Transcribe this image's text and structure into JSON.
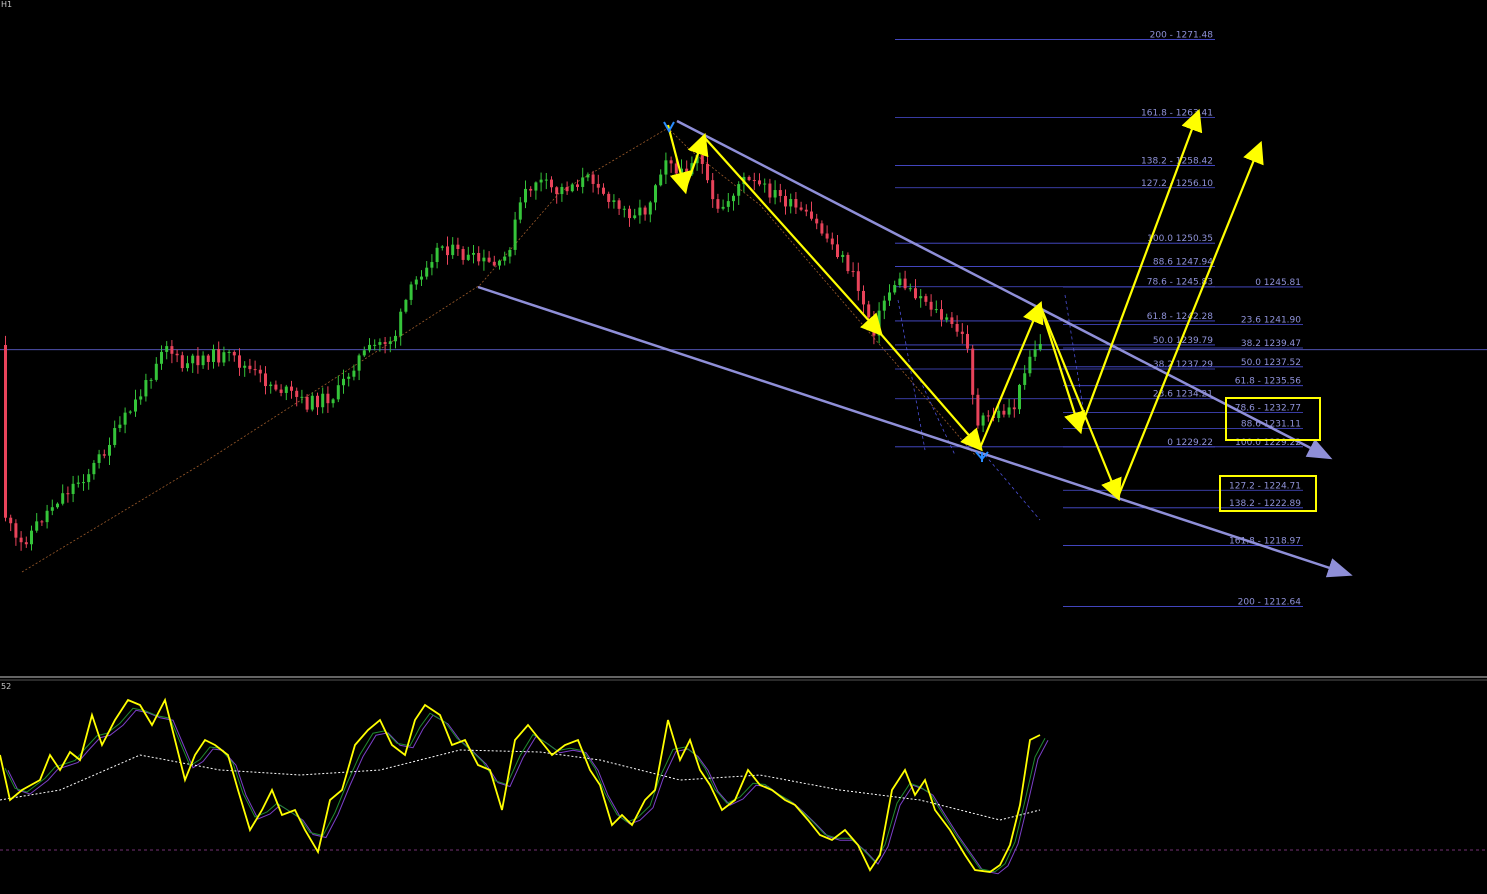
{
  "header": {
    "timeframe": "H1",
    "subwindow_label": "52"
  },
  "colors": {
    "background": "#000000",
    "bull_candle": "#35c43a",
    "bear_candle": "#e8435a",
    "fib_line": "#4b4fd8",
    "fib_text": "#8f92d8",
    "channel": "#8f8fd8",
    "arrow": "#ffff00",
    "signal_green": "#1f8a2e",
    "signal_purple": "#7b3fc8"
  },
  "chart_data": [
    {
      "type": "candlestick",
      "title": "",
      "ylim": [
        1211.5,
        1273.2
      ],
      "fib_extension_upper": [
        {
          "text": "200 - 1271.48",
          "price": 1271.48
        },
        {
          "text": "161.8 - 1263.41",
          "price": 1263.41
        },
        {
          "text": "138.2 - 1258.42",
          "price": 1258.42
        },
        {
          "text": "127.2 - 1256.10",
          "price": 1256.1
        },
        {
          "text": "100.0 1250.35",
          "price": 1250.35
        },
        {
          "text": "88.6 1247.94",
          "price": 1247.94
        },
        {
          "text": "78.6 - 1245.83",
          "price": 1245.83
        },
        {
          "text": "61.8 - 1242.28",
          "price": 1242.28
        },
        {
          "text": "50.0 1239.79",
          "price": 1239.79
        },
        {
          "text": "38.2 1237.29",
          "price": 1237.29
        },
        {
          "text": "23.6 1234.21",
          "price": 1234.21
        },
        {
          "text": "0 1229.22",
          "price": 1229.22
        }
      ],
      "fib_retracement_right": [
        {
          "text": "0 1245.81",
          "price": 1245.81
        },
        {
          "text": "23.6 1241.90",
          "price": 1241.9
        },
        {
          "text": "38.2 1239.47",
          "price": 1239.47
        },
        {
          "text": "50.0 1237.52",
          "price": 1237.52
        },
        {
          "text": "61.8 - 1235.56",
          "price": 1235.56
        },
        {
          "text": "78.6 - 1232.77",
          "price": 1232.77
        },
        {
          "text": "88.6 1231.11",
          "price": 1231.11
        },
        {
          "text": "100.0 1229.22",
          "price": 1229.22
        },
        {
          "text": "127.2 - 1224.71",
          "price": 1224.71
        },
        {
          "text": "138.2 - 1222.89",
          "price": 1222.89
        },
        {
          "text": "161.8 - 1218.97",
          "price": 1218.97
        },
        {
          "text": "200 - 1212.64",
          "price": 1212.64
        }
      ],
      "horizontal_line_price": 1239.3,
      "highlight_zones": [
        {
          "price_high": 1233.5,
          "price_low": 1230.5
        },
        {
          "price_high": 1225.5,
          "price_low": 1222.3
        }
      ],
      "swing_points": [
        {
          "label": "high",
          "price": 1261.5
        },
        {
          "label": "low",
          "price": 1229.22
        }
      ]
    },
    {
      "type": "line",
      "title": "",
      "ylim": [
        0,
        100
      ],
      "level": 20,
      "series": [
        {
          "color": "#ffff00"
        },
        {
          "color": "#1f8a2e"
        },
        {
          "color": "#7b3fc8"
        },
        {
          "color": "#ffffff"
        }
      ]
    }
  ]
}
